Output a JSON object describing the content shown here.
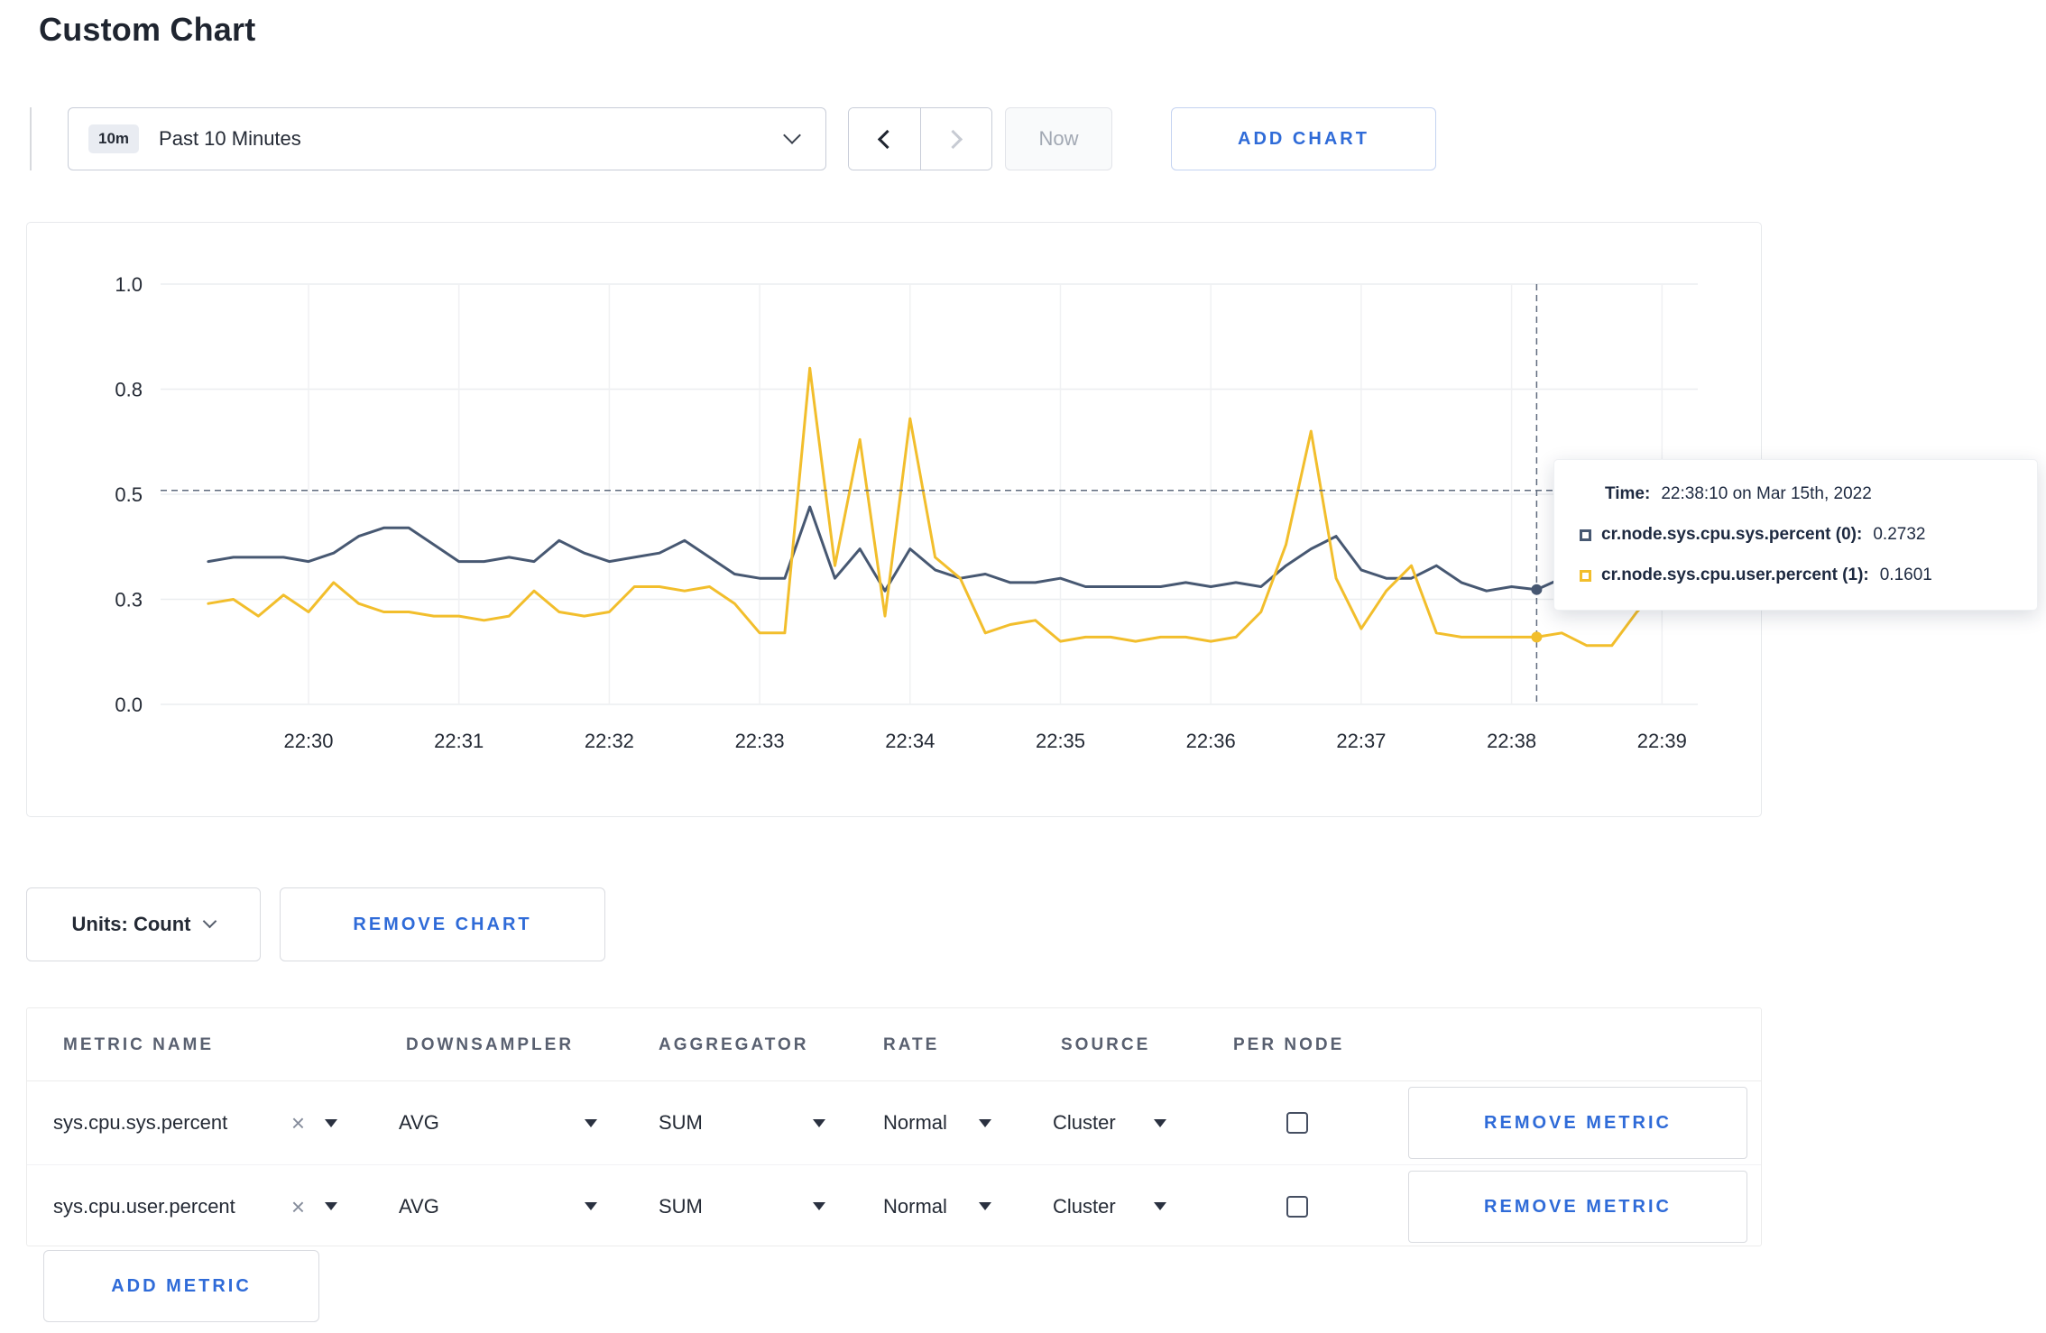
{
  "accent_color": "#2f6bd8",
  "page": {
    "title": "Custom Chart"
  },
  "toolbar": {
    "time_range_badge": "10m",
    "time_range_label": "Past 10 Minutes",
    "now_label": "Now",
    "add_chart_label": "ADD CHART"
  },
  "tooltip": {
    "time_label": "Time:",
    "time_value": "22:38:10 on Mar 15th, 2022",
    "rows": [
      {
        "label": "cr.node.sys.cpu.sys.percent (0):",
        "value": "0.2732"
      },
      {
        "label": "cr.node.sys.cpu.user.percent (1):",
        "value": "0.1601"
      }
    ]
  },
  "chart_controls": {
    "units_label": "Units: Count",
    "remove_chart_label": "REMOVE CHART"
  },
  "metrics_table": {
    "headers": {
      "metric": "METRIC NAME",
      "downsampler": "DOWNSAMPLER",
      "aggregator": "AGGREGATOR",
      "rate": "RATE",
      "source": "SOURCE",
      "per_node": "PER NODE"
    },
    "rows": [
      {
        "metric": "sys.cpu.sys.percent",
        "clear": "×",
        "downsampler": "AVG",
        "aggregator": "SUM",
        "rate": "Normal",
        "source": "Cluster",
        "per_node_checked": false,
        "remove_label": "REMOVE METRIC"
      },
      {
        "metric": "sys.cpu.user.percent",
        "clear": "×",
        "downsampler": "AVG",
        "aggregator": "SUM",
        "rate": "Normal",
        "source": "Cluster",
        "per_node_checked": false,
        "remove_label": "REMOVE METRIC"
      }
    ],
    "add_metric_label": "ADD METRIC"
  },
  "chart_data": {
    "type": "line",
    "title": "",
    "xlabel": "",
    "ylabel": "",
    "grid": true,
    "legend_position": "tooltip",
    "ylim": [
      0,
      1
    ],
    "x_ticks": [
      "22:30",
      "22:31",
      "22:32",
      "22:33",
      "22:34",
      "22:35",
      "22:36",
      "22:37",
      "22:38",
      "22:39"
    ],
    "y_ticks": {
      "values": [
        0,
        0.25,
        0.5,
        0.75,
        1
      ],
      "labels": [
        "0.0",
        "0.3",
        "0.5",
        "0.8",
        "1.0"
      ]
    },
    "x_start": "22:29:20",
    "x_interval_seconds": 10,
    "series": [
      {
        "name": "cr.node.sys.cpu.sys.percent",
        "color": "#475872",
        "values": [
          0.34,
          0.35,
          0.35,
          0.35,
          0.34,
          0.36,
          0.4,
          0.42,
          0.42,
          0.38,
          0.34,
          0.34,
          0.35,
          0.34,
          0.39,
          0.36,
          0.34,
          0.35,
          0.36,
          0.39,
          0.35,
          0.31,
          0.3,
          0.3,
          0.47,
          0.3,
          0.37,
          0.27,
          0.37,
          0.32,
          0.3,
          0.31,
          0.29,
          0.29,
          0.3,
          0.28,
          0.28,
          0.28,
          0.28,
          0.29,
          0.28,
          0.29,
          0.28,
          0.33,
          0.37,
          0.4,
          0.32,
          0.3,
          0.3,
          0.33,
          0.29,
          0.27,
          0.28,
          0.2732,
          0.3,
          0.27,
          0.31,
          0.31,
          0.29,
          0.3
        ]
      },
      {
        "name": "cr.node.sys.cpu.user.percent",
        "color": "#f2be2c",
        "values": [
          0.24,
          0.25,
          0.21,
          0.26,
          0.22,
          0.29,
          0.24,
          0.22,
          0.22,
          0.21,
          0.21,
          0.2,
          0.21,
          0.27,
          0.22,
          0.21,
          0.22,
          0.28,
          0.28,
          0.27,
          0.28,
          0.24,
          0.17,
          0.17,
          0.8,
          0.33,
          0.63,
          0.21,
          0.68,
          0.35,
          0.3,
          0.17,
          0.19,
          0.2,
          0.15,
          0.16,
          0.16,
          0.15,
          0.16,
          0.16,
          0.15,
          0.16,
          0.22,
          0.38,
          0.65,
          0.3,
          0.18,
          0.27,
          0.33,
          0.17,
          0.16,
          0.16,
          0.16,
          0.1601,
          0.17,
          0.14,
          0.14,
          0.22,
          0.28,
          0.23
        ]
      }
    ],
    "crosshair": {
      "time": "22:38:10",
      "y_value": 0.509
    }
  }
}
